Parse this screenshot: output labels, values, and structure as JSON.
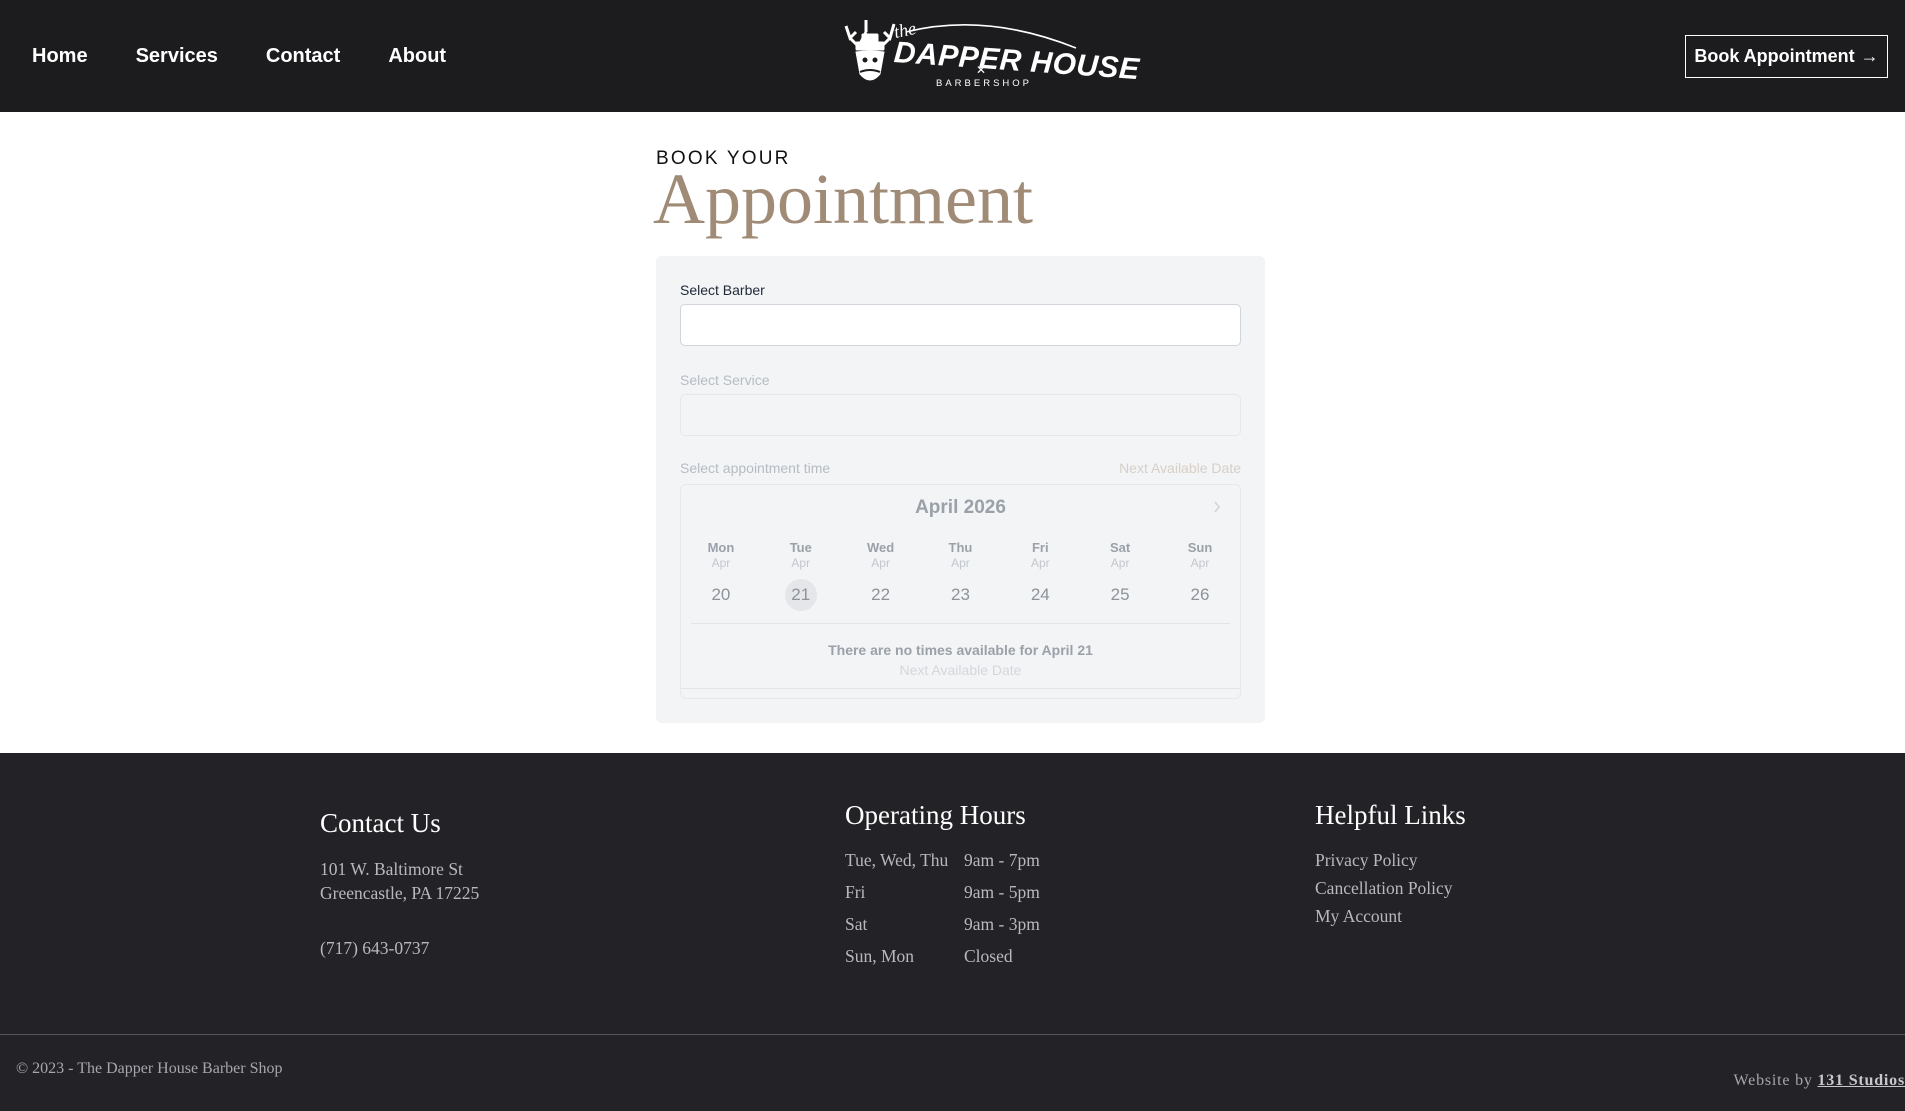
{
  "header": {
    "nav": [
      "Home",
      "Services",
      "Contact",
      "About"
    ],
    "logo": {
      "the": "the",
      "name": "DAPPER HOUSE",
      "tagline": "BARBERSHOP"
    },
    "book_button": "Book Appointment",
    "book_button_arrow": "→"
  },
  "booking": {
    "kicker": "BOOK YOUR",
    "title": "Appointment",
    "barber_label": "Select Barber",
    "barber_value": "",
    "service_label": "Select Service",
    "service_value": "",
    "time_label": "Select appointment time",
    "next_available": "Next Available Date",
    "calendar": {
      "month": "April 2026",
      "days": [
        {
          "dow": "Mon",
          "mon": "Apr",
          "num": "20"
        },
        {
          "dow": "Tue",
          "mon": "Apr",
          "num": "21"
        },
        {
          "dow": "Wed",
          "mon": "Apr",
          "num": "22"
        },
        {
          "dow": "Thu",
          "mon": "Apr",
          "num": "23"
        },
        {
          "dow": "Fri",
          "mon": "Apr",
          "num": "24"
        },
        {
          "dow": "Sat",
          "mon": "Apr",
          "num": "25"
        },
        {
          "dow": "Sun",
          "mon": "Apr",
          "num": "26"
        }
      ],
      "no_times": "There are no times available for April 21",
      "next_available": "Next Available Date"
    }
  },
  "footer": {
    "contact": {
      "heading": "Contact Us",
      "address1": "101 W. Baltimore St",
      "address2": "Greencastle, PA 17225",
      "phone": "(717) 643-0737"
    },
    "hours": {
      "heading": "Operating Hours",
      "rows": [
        {
          "days": "Tue, Wed, Thu",
          "hours": "9am - 7pm"
        },
        {
          "days": "Fri",
          "hours": "9am - 5pm"
        },
        {
          "days": "Sat",
          "hours": "9am - 3pm"
        },
        {
          "days": "Sun, Mon",
          "hours": "Closed"
        }
      ]
    },
    "links": {
      "heading": "Helpful Links",
      "items": [
        "Privacy Policy",
        "Cancellation Policy",
        "My Account"
      ]
    },
    "copyright": "© 2023 - The Dapper House Barber Shop",
    "credit_prefix": "Website by",
    "credit_link": "131 Studios"
  },
  "colors": {
    "header_bg": "#1c1c1e",
    "accent": "#a08b77",
    "footer_bg": "#232227"
  }
}
